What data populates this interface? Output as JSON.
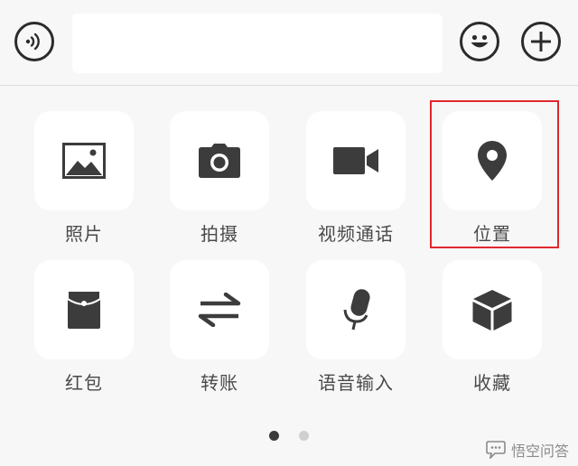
{
  "input": {
    "value": "",
    "placeholder": ""
  },
  "icons": {
    "voice": "voice-wave-icon",
    "emoji": "smiley-icon",
    "more": "plus-icon"
  },
  "grid": [
    {
      "label": "照片",
      "icon": "image-icon"
    },
    {
      "label": "拍摄",
      "icon": "camera-icon"
    },
    {
      "label": "视频通话",
      "icon": "video-camera-icon"
    },
    {
      "label": "位置",
      "icon": "location-pin-icon"
    },
    {
      "label": "红包",
      "icon": "red-envelope-icon"
    },
    {
      "label": "转账",
      "icon": "transfer-arrows-icon"
    },
    {
      "label": "语音输入",
      "icon": "microphone-icon"
    },
    {
      "label": "收藏",
      "icon": "cube-icon"
    }
  ],
  "highlighted_item": "位置",
  "pagination": {
    "current": 1,
    "total": 2
  },
  "watermark": {
    "text": "悟空问答"
  },
  "colors": {
    "background": "#f7f7f7",
    "tile": "#ffffff",
    "icon": "#3c3c3c",
    "label": "#4a4a4a",
    "highlight_border": "#e0282e",
    "dot_active": "#3a3a3a",
    "dot_inactive": "#cfcfcf"
  }
}
